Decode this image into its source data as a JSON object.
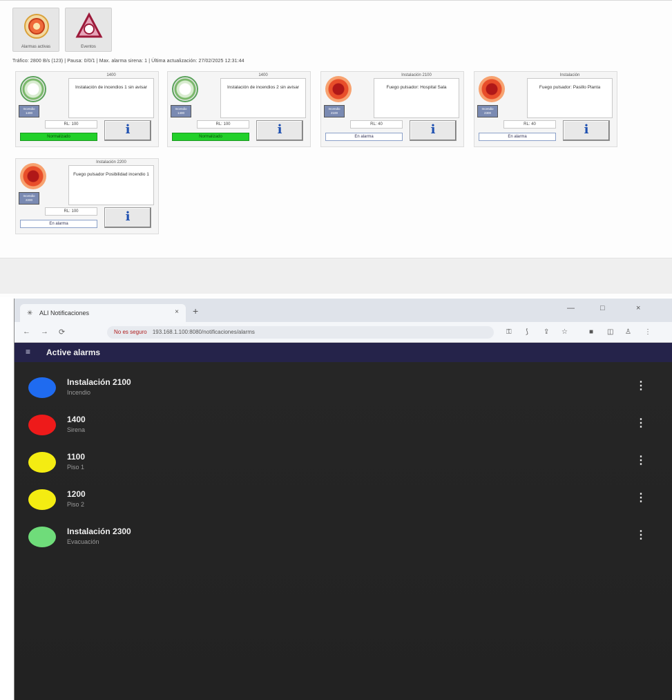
{
  "toolbar": {
    "buttons": [
      {
        "label": "Alarmas activas",
        "icon": "alarm-bell-icon"
      },
      {
        "label": "Eventos",
        "icon": "triangle-warning-icon"
      }
    ],
    "status_line": "Tráfico: 2800 B/s (123) | Pausa: 0/0/1 | Max. alarma sirena: 1 | Última actualización: 27/02/2025 12:31:44"
  },
  "cards": [
    {
      "title": "1400",
      "description": "Instalación de incendios 1 sin avisar",
      "tag": "Incendio 1400",
      "value": "RL: 100",
      "state": "Normalizado",
      "status": "ok",
      "info_label": "i"
    },
    {
      "title": "1400",
      "description": "Instalación de incendios 2 sin avisar",
      "tag": "Incendio 1400",
      "value": "RL: 100",
      "state": "Normalizado",
      "status": "ok",
      "info_label": "i"
    },
    {
      "title": "Instalación 2100",
      "description": "Fuego pulsador: Hospital Sala",
      "tag": "Incendio 2100",
      "value": "RL: 40",
      "state": "En alarma",
      "status": "alarm",
      "info_label": "i"
    },
    {
      "title": "Instalación",
      "description": "Fuego pulsador: Pasillo Planta",
      "tag": "Incendio 2300",
      "value": "RL: 40",
      "state": "En alarma",
      "status": "alarm",
      "info_label": "i"
    },
    {
      "title": "Instalación 2200",
      "description": "Fuego pulsador Posibilidad incendio 1",
      "tag": "Incendio 2200",
      "value": "RL: 100",
      "state": "En alarma",
      "status": "alarm",
      "info_label": "i"
    }
  ],
  "browser": {
    "tab_title": "ALI Notificaciones",
    "tab_close": "×",
    "new_tab": "+",
    "window_controls": [
      "—",
      "□",
      "×"
    ],
    "nav": [
      "←",
      "→",
      "⟳"
    ],
    "url_warning": "No es seguro",
    "url": "193.168.1.100:8080/notificaciones/alarms"
  },
  "app": {
    "menu_icon": "≡",
    "title": "Active alarms",
    "alarms": [
      {
        "title": "Instalación 2100",
        "subtitle": "Incendio",
        "color": "#1f6bf0"
      },
      {
        "title": "1400",
        "subtitle": "Sirena",
        "color": "#ee1a1a"
      },
      {
        "title": "1100",
        "subtitle": "Piso 1",
        "color": "#f4ec12"
      },
      {
        "title": "1200",
        "subtitle": "Piso 2",
        "color": "#f4ec12"
      },
      {
        "title": "Instalación 2300",
        "subtitle": "Evacuación",
        "color": "#6fdc7a"
      }
    ],
    "more_icon": "⋮"
  }
}
